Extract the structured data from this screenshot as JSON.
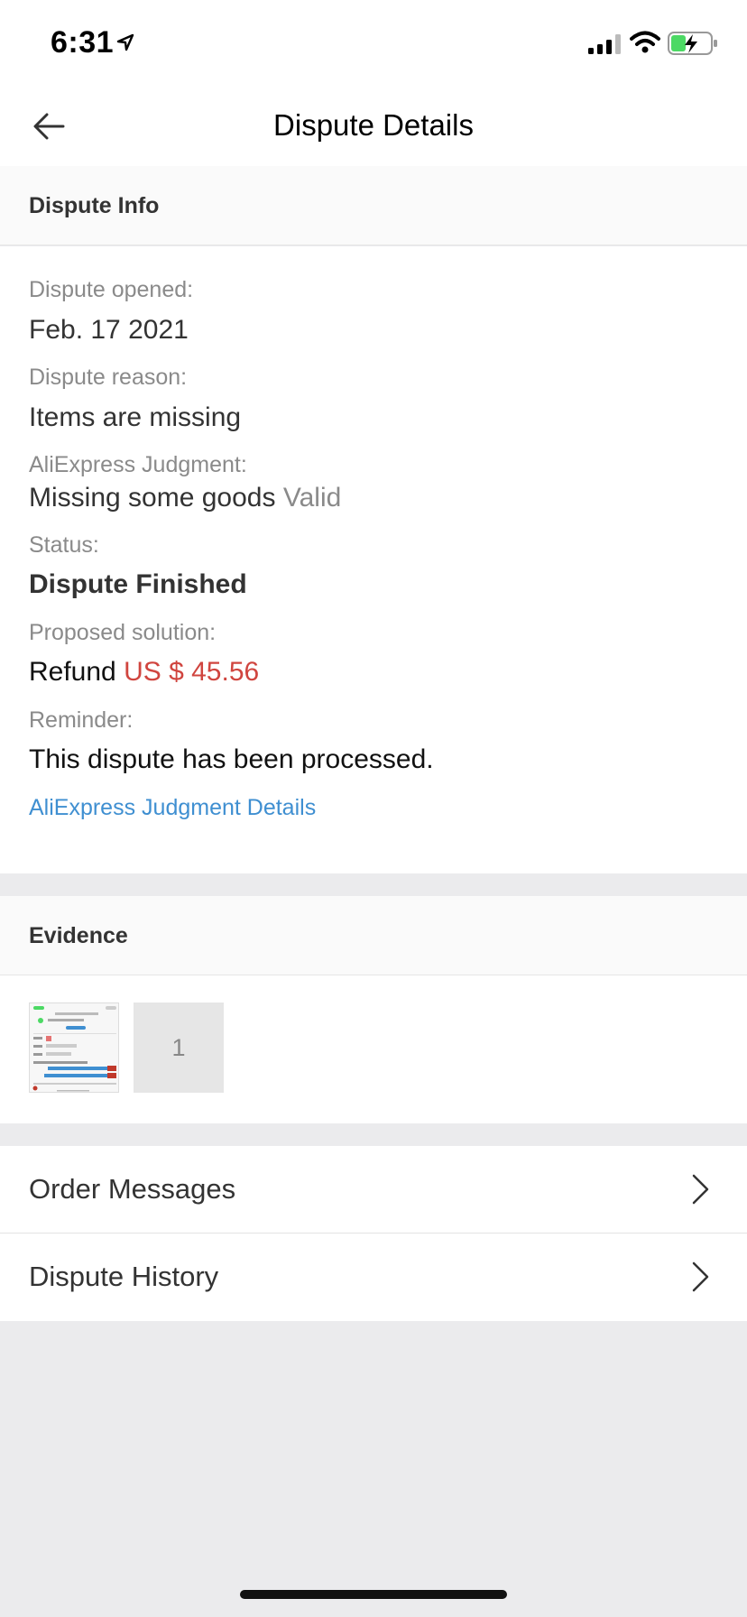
{
  "status_bar": {
    "time": "6:31",
    "icons": [
      "location-arrow-icon",
      "cellular-signal-icon",
      "wifi-icon",
      "battery-charging-icon"
    ]
  },
  "nav": {
    "title": "Dispute Details",
    "back_icon": "back-arrow-icon"
  },
  "dispute_info": {
    "header": "Dispute Info",
    "opened_label": "Dispute opened:",
    "opened_value": "Feb. 17 2021",
    "reason_label": "Dispute reason:",
    "reason_value": "Items are missing",
    "judgment_label": "AliExpress Judgment:",
    "judgment_value": "Missing some goods",
    "judgment_verdict": "Valid",
    "status_label": "Status:",
    "status_value": "Dispute Finished",
    "solution_label": "Proposed solution:",
    "solution_prefix": "Refund",
    "solution_amount": "US $ 45.56",
    "reminder_label": "Reminder:",
    "reminder_value": "This dispute has been processed.",
    "details_link": "AliExpress Judgment Details"
  },
  "evidence": {
    "header": "Evidence",
    "extra_count": "1"
  },
  "menu": {
    "items": [
      {
        "label": "Order Messages"
      },
      {
        "label": "Dispute History"
      }
    ]
  },
  "colors": {
    "price": "#d0453f",
    "link": "#3f8fd1",
    "battery_green": "#4cd964",
    "background": "#ebebed"
  }
}
